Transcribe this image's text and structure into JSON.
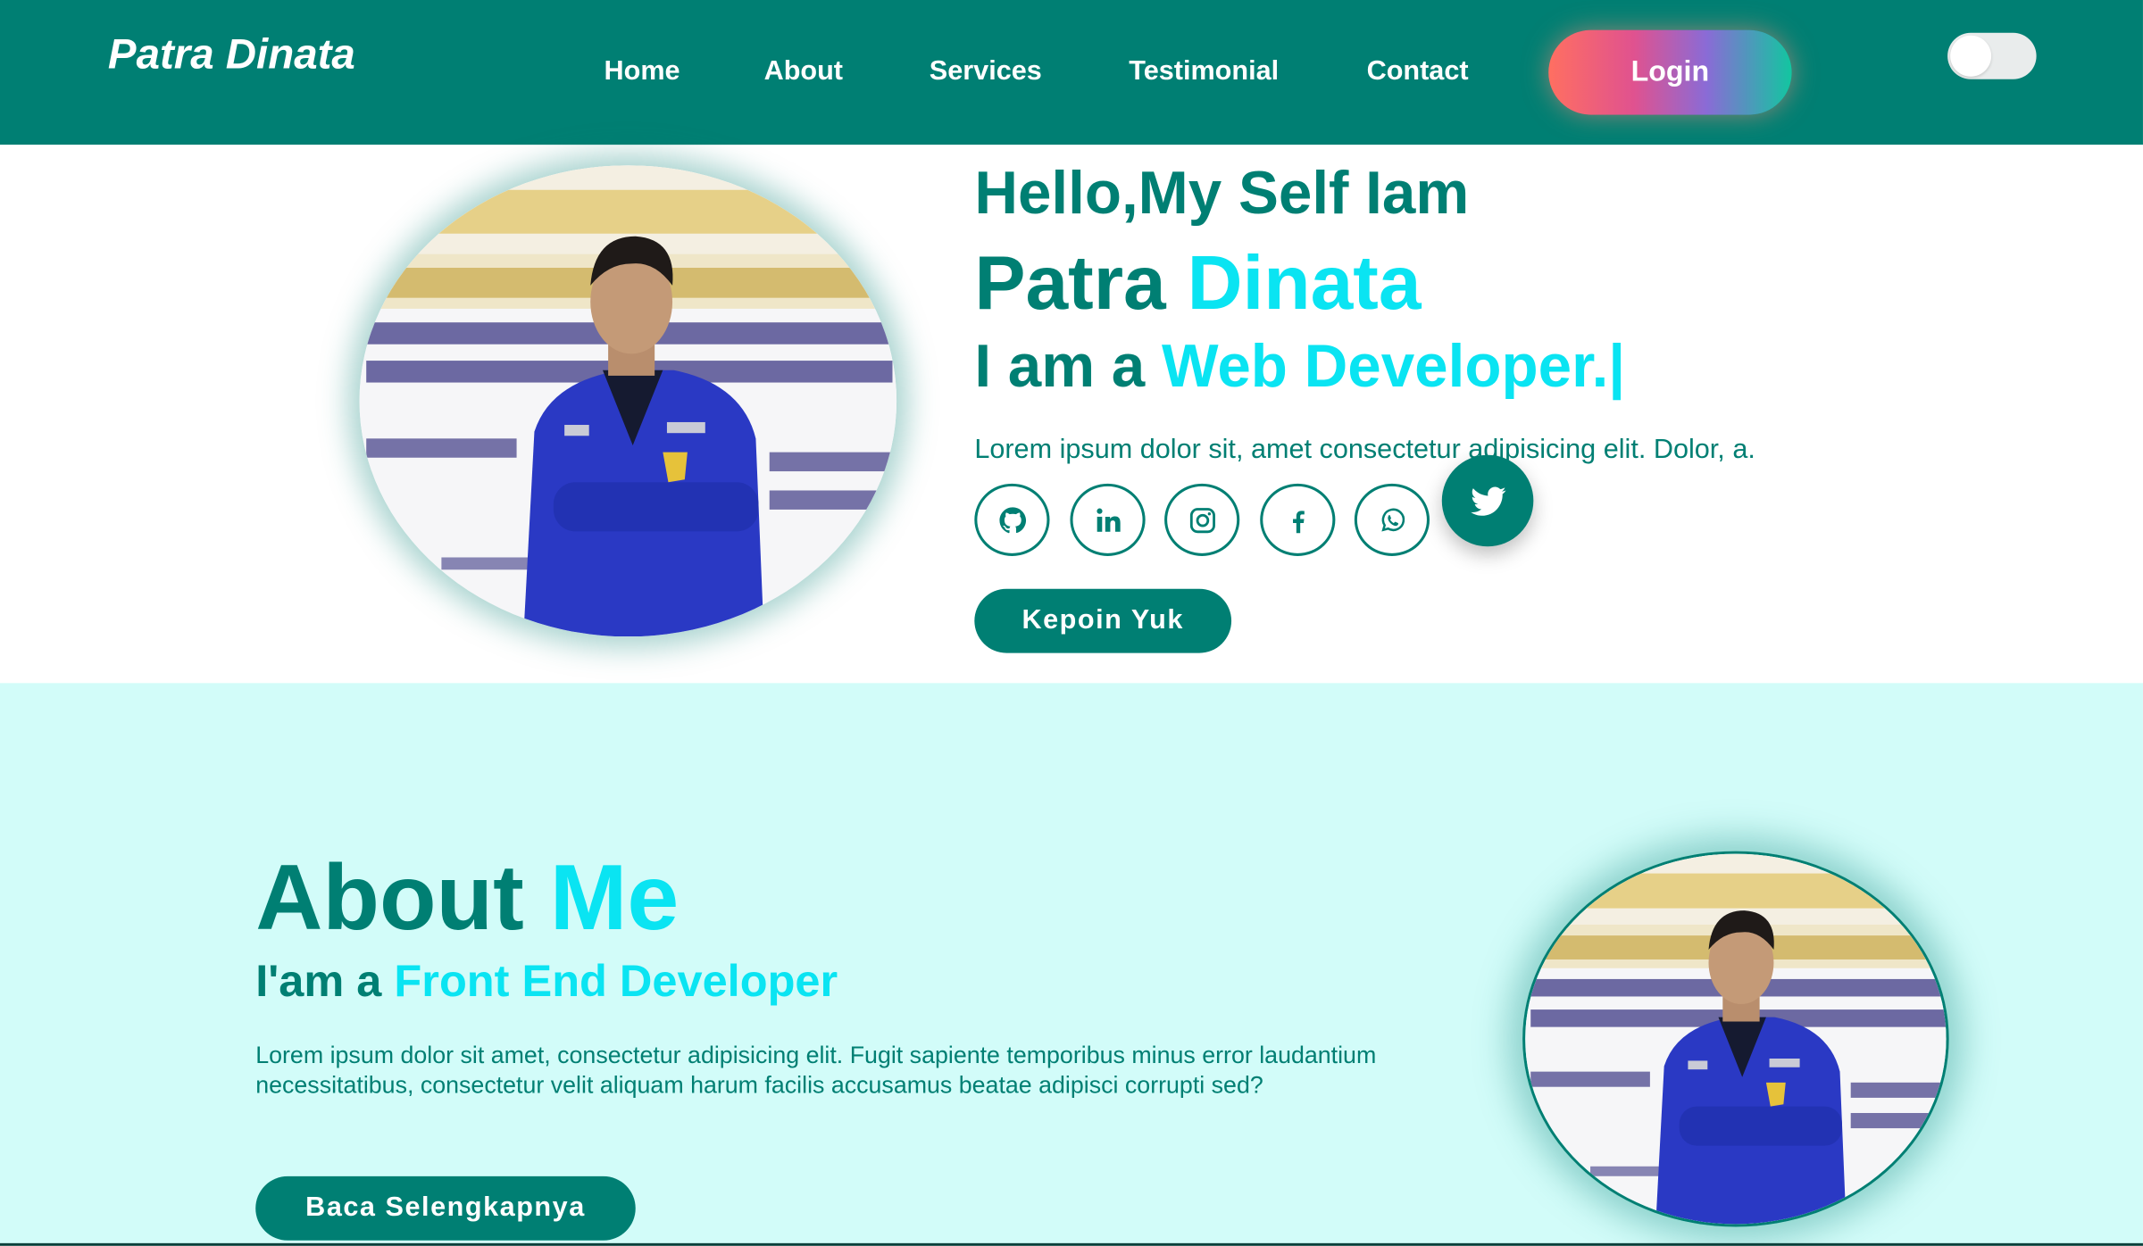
{
  "nav": {
    "brand": "Patra Dinata",
    "items": [
      "Home",
      "About",
      "Services",
      "Testimonial",
      "Contact"
    ],
    "login_label": "Login",
    "theme_toggle": "off"
  },
  "hero": {
    "greeting": "Hello,My Self Iam",
    "name_first": "Patra",
    "name_last": "Dinata",
    "role_prefix": "I am a",
    "role_highlight": "Web Developer.|",
    "description": "Lorem ipsum dolor sit, amet consectetur adipisicing elit. Dolor, a.",
    "socials": [
      "github-icon",
      "linkedin-icon",
      "instagram-icon",
      "facebook-icon",
      "whatsapp-icon",
      "twitter-icon"
    ],
    "cta_label": "Kepoin Yuk"
  },
  "about": {
    "title_main": "About",
    "title_highlight": "Me",
    "subtitle_prefix": "I'am a",
    "subtitle_highlight": "Front End Developer",
    "paragraph": "Lorem ipsum dolor sit amet, consectetur adipisicing elit. Fugit sapiente temporibus minus error laudantium necessitatibus, consectetur velit aliquam harum facilis accusamus beatae adipisci corrupti sed?",
    "cta_label": "Baca Selengkapnya"
  },
  "colors": {
    "primary": "#007f73",
    "accent": "#0ae4f2",
    "about_bg": "#d2fcf9"
  }
}
